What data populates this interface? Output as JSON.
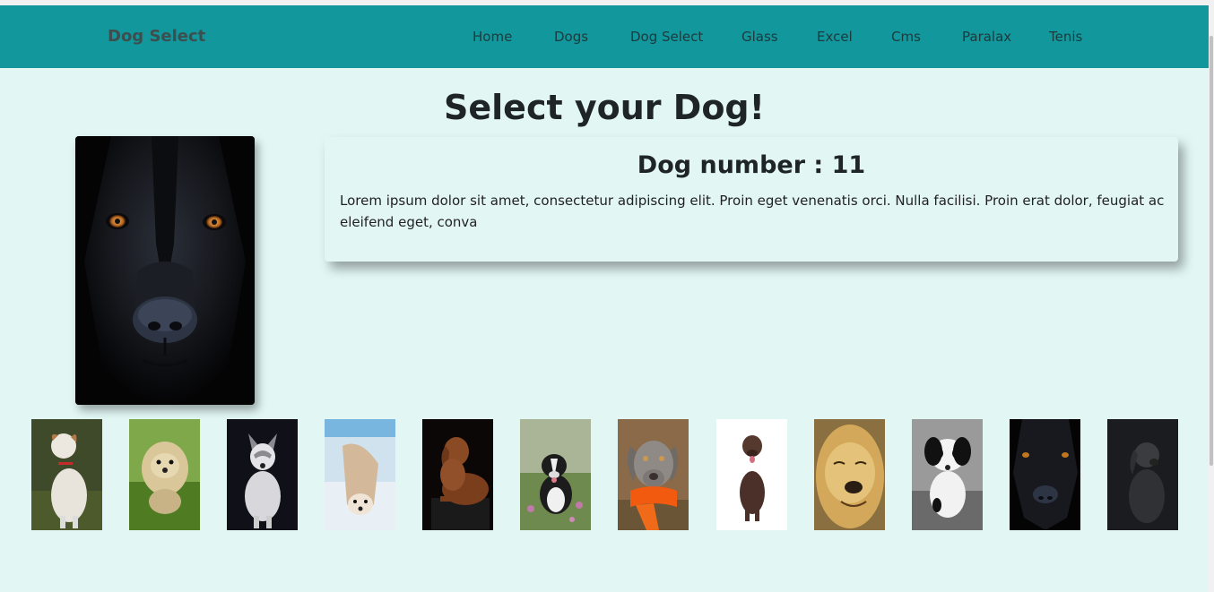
{
  "navbar": {
    "brand": "Dog Select",
    "links": [
      "Home",
      "Dogs",
      "Dog Select",
      "Glass",
      "Excel",
      "Cms",
      "Paralax",
      "Tenis"
    ],
    "bg_color": "#12979d"
  },
  "page": {
    "title": "Select your Dog!",
    "background": "#e2f7f4"
  },
  "selected": {
    "title": "Dog number : 11",
    "description": "Lorem ipsum dolor sit amet, consectetur adipiscing elit. Proin eget venenatis orci. Nulla facilisi. Proin erat dolor, feugiat ac eleifend eget, conva"
  },
  "thumbnails": [
    {
      "name": "dog-1",
      "desc": "white terrier with red collar on grass"
    },
    {
      "name": "dog-2",
      "desc": "fluffy yorkie on green grass"
    },
    {
      "name": "dog-3",
      "desc": "husky puppy on dark background"
    },
    {
      "name": "dog-4",
      "desc": "husky playing in snow"
    },
    {
      "name": "dog-5",
      "desc": "brown vizsla lying on dark background"
    },
    {
      "name": "dog-6",
      "desc": "black and white dog in flowers"
    },
    {
      "name": "dog-7",
      "desc": "weimaraner with orange scarf"
    },
    {
      "name": "dog-8",
      "desc": "chocolate labrador on white"
    },
    {
      "name": "dog-9",
      "desc": "golden retriever smiling"
    },
    {
      "name": "dog-10",
      "desc": "black and white puppy"
    },
    {
      "name": "dog-11",
      "desc": "black shepherd face"
    },
    {
      "name": "dog-12",
      "desc": "dark grey dog on black"
    }
  ]
}
